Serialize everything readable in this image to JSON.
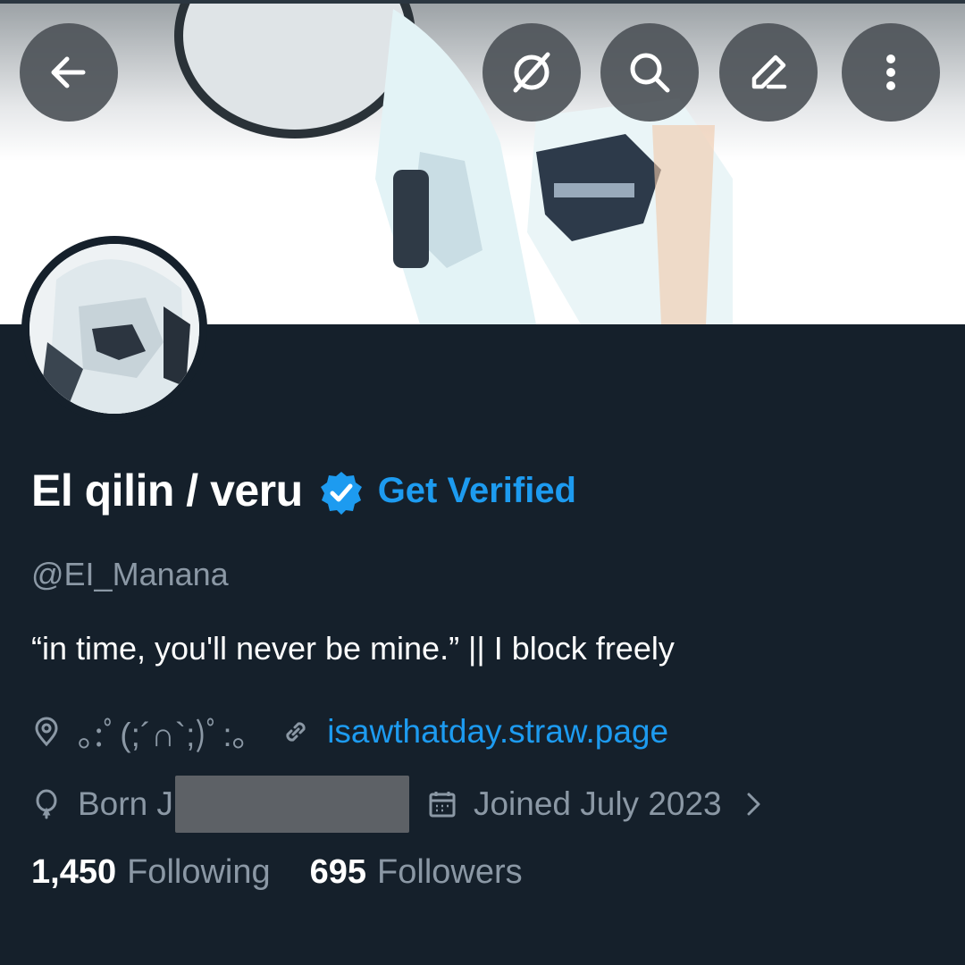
{
  "header": {
    "back_icon": "arrow-left-icon",
    "actions": [
      "grok-icon",
      "search-icon",
      "edit-icon",
      "more-vertical-icon"
    ]
  },
  "profile": {
    "display_name": "El qilin / veru",
    "verified_icon": "verified-badge-icon",
    "get_verified_label": "Get Verified",
    "handle": "@EI_Manana",
    "bio": "“in time, you'll never be mine.” || I block freely",
    "location": "｡:ﾟ(;´∩`;)ﾟ:｡",
    "website": "isawthatday.straw.page",
    "birthday_visible": "Born J",
    "joined": "Joined July 2023"
  },
  "stats": {
    "following_count": "1,450",
    "following_label": "Following",
    "followers_count": "695",
    "followers_label": "Followers"
  },
  "colors": {
    "background": "#15202b",
    "accent": "#1d9bf0",
    "secondary_text": "#8b98a5"
  }
}
